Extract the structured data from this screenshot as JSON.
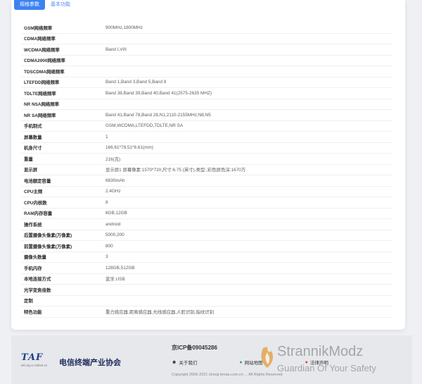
{
  "tabs": [
    {
      "label": "规格参数",
      "active": true
    },
    {
      "label": "基本功能",
      "active": false
    }
  ],
  "specs": [
    {
      "label": "GSM网络频率",
      "value": "900MHz,1800MHz"
    },
    {
      "label": "CDMA网络频率",
      "value": ""
    },
    {
      "label": "WCDMA网络频率",
      "value": "Band I,VIII"
    },
    {
      "label": "CDMA2000网络频率",
      "value": ""
    },
    {
      "label": "TDSCDMA网络频率",
      "value": ""
    },
    {
      "label": "LTEFDD网络频率",
      "value": "Band 1,Band 3,Band 5,Band 8"
    },
    {
      "label": "TDLTE网络频率",
      "value": "Band 38,Band 39,Band 40,Band 41(2575-2635 MHZ)"
    },
    {
      "label": "NR NSA网络频率",
      "value": ""
    },
    {
      "label": "NR SA网络频率",
      "value": "Band 41,Band 78,Band 28,N1,2110-2155MHz,N8,N5"
    },
    {
      "label": "手机制式",
      "value": "GSM,WCDMA,LTEFDD,TDLTE,NR SA"
    },
    {
      "label": "屏幕数量",
      "value": "1"
    },
    {
      "label": "机身尺寸",
      "value": "166.61*78.51*8.61(mm)"
    },
    {
      "label": "重量",
      "value": "216(克)"
    },
    {
      "label": "显示屏",
      "value": "显示屏1 屏幕像素:1570*720,尺寸:6.75 (英寸),类型:,彩色屏色深:1670万"
    },
    {
      "label": "电池额定容量",
      "value": "6830mAh"
    },
    {
      "label": "CPU主频",
      "value": "2.4GHz"
    },
    {
      "label": "CPU内核数",
      "value": "8"
    },
    {
      "label": "RAM内存容量",
      "value": "8GB,12GB"
    },
    {
      "label": "操作系统",
      "value": "android"
    },
    {
      "label": "后置摄像头像素(万像素)",
      "value": "5000,200"
    },
    {
      "label": "前置摄像头像素(万像素)",
      "value": "800"
    },
    {
      "label": "摄像头数量",
      "value": "3"
    },
    {
      "label": "手机内存",
      "value": "128GB,512GB"
    },
    {
      "label": "本地连接方式",
      "value": "蓝牙,USB"
    },
    {
      "label": "光学变焦倍数",
      "value": ""
    },
    {
      "label": "定制",
      "value": ""
    },
    {
      "label": "特色功能",
      "value": "重力感应器,距离感应器,光线感应器,人脸识别,指纹识别"
    }
  ],
  "footer": {
    "logo_mark": "TAF",
    "logo_sub": "taf.org.cn   tafnet.cn",
    "org_name": "电信终端产业协会",
    "icp": "京ICP备09045286",
    "links": [
      {
        "label": "关于我们",
        "icon": "people-icon"
      },
      {
        "label": "网站地图",
        "icon": "map-pin-icon"
      },
      {
        "label": "法律声明",
        "icon": "legal-icon"
      }
    ],
    "copyright": "Copyright 2006-2021 shouji.tenaa.com.cn   ...   All Rights Reserved"
  },
  "watermark": {
    "title": "StrannikModz",
    "tagline": "Guardian Of Your Safety"
  },
  "colors": {
    "accent": "#3d82f2",
    "label": "#2d2d2d",
    "value": "#5c5c5c",
    "footer_bg": "#e7e8ec"
  }
}
